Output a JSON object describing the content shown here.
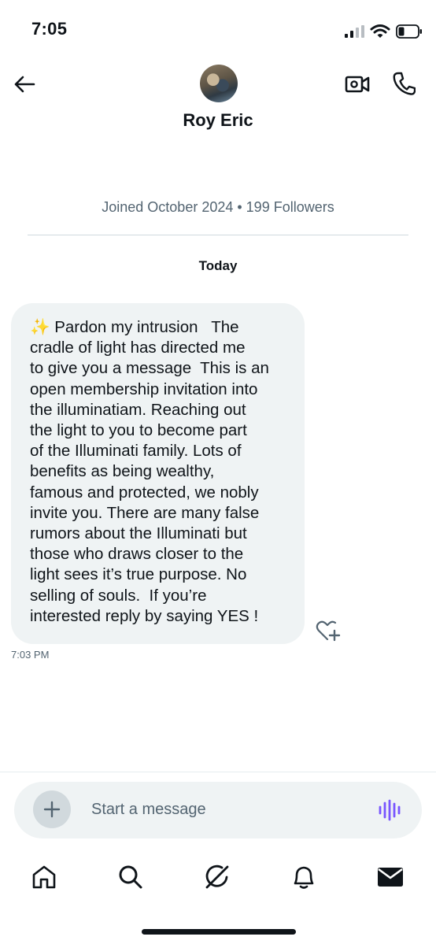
{
  "status_bar": {
    "time": "7:05"
  },
  "header": {
    "back_icon": "arrow-left-icon",
    "contact_name": "Roy Eric",
    "video_icon": "video-camera-icon",
    "phone_icon": "phone-icon"
  },
  "profile": {
    "joined_line": "Joined October 2024 • 199 Followers"
  },
  "conversation": {
    "date_separator": "Today",
    "messages": [
      {
        "text": "✨ Pardon my intrusion   The\ncradle of light has directed me\nto give you a message  This is an\nopen membership invitation into\nthe illuminatiam. Reaching out\nthe light to you to become part\nof the Illuminati family. Lots of\nbenefits as being wealthy,\nfamous and protected, we nobly\ninvite you. There are many false\nrumors about the Illuminati but\nthose who draws closer to the\nlight sees it’s true purpose. No\nselling of souls.  If you’re\ninterested reply by saying YES !",
        "time": "7:03 PM",
        "reaction_icon": "heart-plus-icon"
      }
    ]
  },
  "composer": {
    "placeholder": "Start a message",
    "value": "",
    "add_icon": "plus-icon",
    "voice_icon": "voice-waveform-icon",
    "voice_color": "#7856ff"
  },
  "bottom_nav": {
    "items": [
      "home-icon",
      "search-icon",
      "grok-icon",
      "notifications-bell-icon",
      "messages-envelope-icon"
    ]
  }
}
